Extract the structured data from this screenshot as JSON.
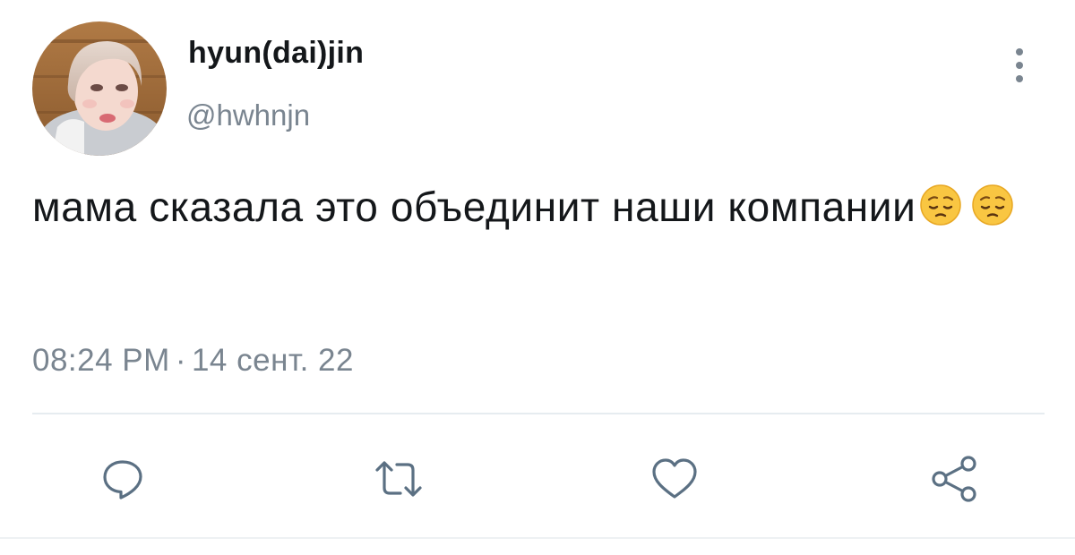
{
  "user": {
    "display_name": "hyun(dai)jin",
    "handle": "@hwhnjn",
    "avatar_icon": "profile-photo"
  },
  "tweet": {
    "text": "мама сказала это объединит наши компании",
    "emojis": [
      "pensive-face-emoji",
      "pensive-face-emoji"
    ],
    "time": "08:24 PM",
    "separator": "·",
    "date": "14 сент. 22"
  },
  "actions": {
    "reply_icon": "reply-icon",
    "retweet_icon": "retweet-icon",
    "like_icon": "heart-icon",
    "share_icon": "share-icon",
    "more_icon": "more-vertical-icon"
  },
  "colors": {
    "text": "#14171a",
    "secondary": "#7a8590",
    "action_icon": "#5b7083",
    "divider": "#e6ecf0"
  }
}
